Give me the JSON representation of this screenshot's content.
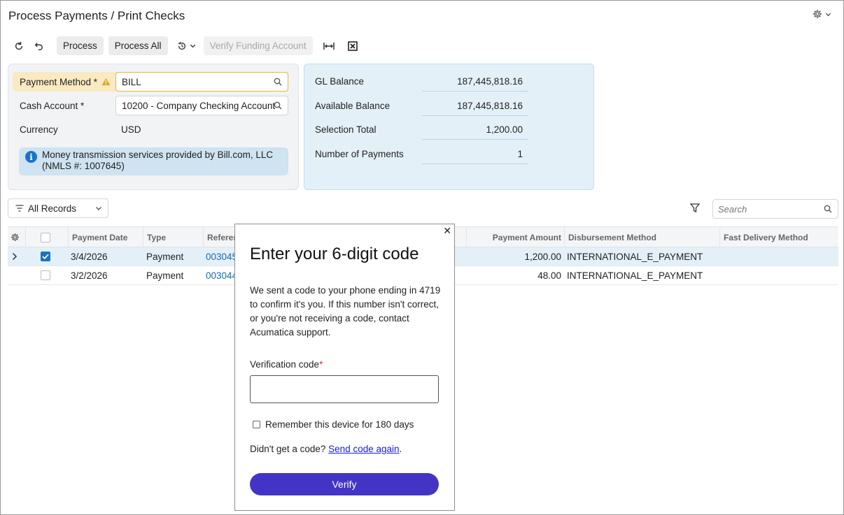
{
  "window": {
    "title": "Process Payments / Print Checks"
  },
  "toolbar": {
    "process_label": "Process",
    "process_all_label": "Process All",
    "verify_funding_label": "Verify Funding Account"
  },
  "form": {
    "payment_method": {
      "label": "Payment Method *",
      "value": "BILL"
    },
    "cash_account": {
      "label": "Cash Account *",
      "value": "10200 - Company Checking Account"
    },
    "currency": {
      "label": "Currency",
      "value": "USD"
    },
    "info": "Money transmission services provided by Bill.com, LLC (NMLS #: 1007645)"
  },
  "summary": {
    "gl_balance": {
      "label": "GL Balance",
      "value": "187,445,818.16"
    },
    "available_balance": {
      "label": "Available Balance",
      "value": "187,445,818.16"
    },
    "selection_total": {
      "label": "Selection Total",
      "value": "1,200.00"
    },
    "number_of_payments": {
      "label": "Number of Payments",
      "value": "1"
    }
  },
  "grid": {
    "filter_label": "All Records",
    "search_placeholder": "Search",
    "columns": {
      "payment_date": "Payment Date",
      "type": "Type",
      "reference": "Referen",
      "payment_amount": "Payment Amount",
      "disbursement_method": "Disbursement Method",
      "fast_delivery_method": "Fast Delivery Method"
    },
    "rows": [
      {
        "date": "3/4/2026",
        "type": "Payment",
        "ref": "003045",
        "amount": "1,200.00",
        "method": "INTERNATIONAL_E_PAYMENT",
        "fast": ""
      },
      {
        "date": "3/2/2026",
        "type": "Payment",
        "ref": "003044",
        "amount": "48.00",
        "method": "INTERNATIONAL_E_PAYMENT",
        "fast": ""
      }
    ]
  },
  "modal": {
    "title": "Enter your 6-digit code",
    "description": "We sent a code to your phone ending in 4719 to confirm it's you. If this number isn't correct, or you're not receiving a code, contact Acumatica support.",
    "code_label": "Verification code",
    "code_required": "*",
    "code_value": "",
    "remember_label": "Remember this device for 180 days",
    "resend_prefix": "Didn't get a code?",
    "resend_link": "Send code again",
    "resend_suffix": ".",
    "verify_label": "Verify",
    "close_glyph": "✕"
  },
  "colors": {
    "accent": "#1a73c8",
    "warning_bg": "#fbe9c2",
    "verify_button": "#4434c6",
    "link": "#1769b5"
  }
}
